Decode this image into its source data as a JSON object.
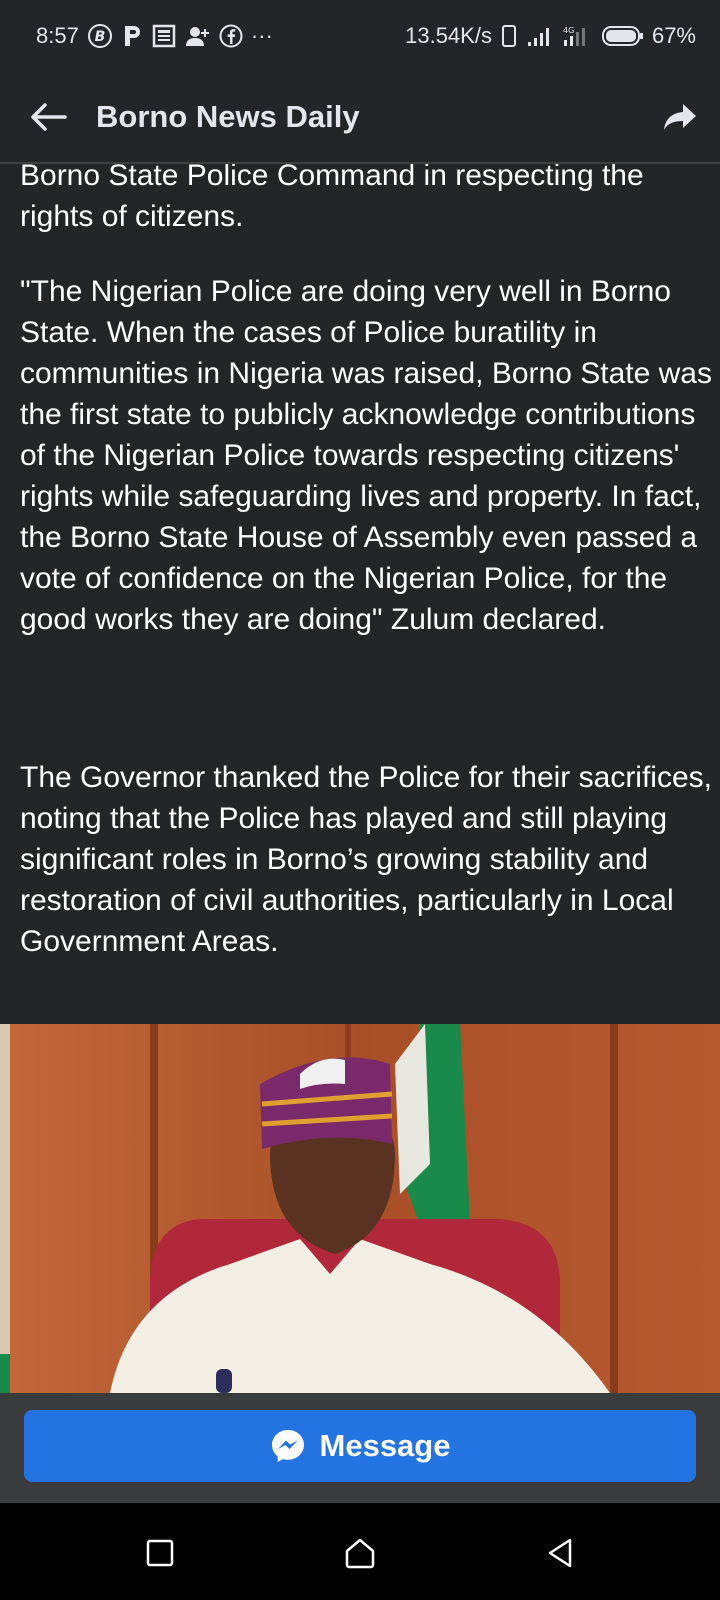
{
  "status_bar": {
    "time": "8:57",
    "network_speed": "13.54K/s",
    "battery": "67%",
    "more_indicator": "···"
  },
  "app_bar": {
    "title": "Borno News Daily"
  },
  "article": {
    "previous_paragraph_tail": "Borno State Police Command in respecting the rights of citizens.",
    "paragraphs": [
      "\"The Nigerian Police are doing very well in Borno State. When the cases of Police buratility in communities in Nigeria was raised, Borno State was the first state to publicly acknowledge contributions of the Nigerian Police towards respecting citizens' rights while safeguarding lives and property. In fact, the Borno State House of Assembly even passed a vote of confidence on the Nigerian Police, for the good works they are doing\" Zulum declared.",
      "The Governor thanked the Police for their sacrifices, noting that the Police has played and still playing significant roles in Borno’s growing stability and restoration of civil authorities, particularly in Local Government Areas."
    ]
  },
  "message_button": {
    "label": "Message"
  },
  "colors": {
    "background": "#242526",
    "accent": "#2374e1",
    "bottom_bar": "#3a3b3c"
  }
}
